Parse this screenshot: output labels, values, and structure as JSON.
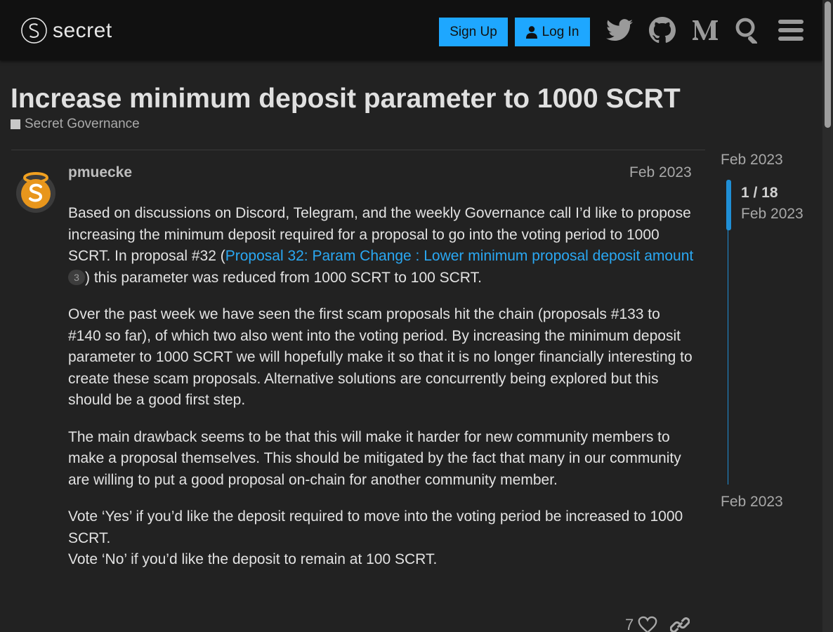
{
  "header": {
    "logo_text": "secret",
    "signup_label": "Sign Up",
    "login_label": "Log In",
    "icons": [
      "twitter-icon",
      "github-icon",
      "medium-icon",
      "search-icon",
      "hamburger-menu-icon"
    ],
    "accent_color": "#1ea7ff"
  },
  "topic": {
    "title": "Increase minimum deposit parameter to 1000 SCRT",
    "category": "Secret Governance"
  },
  "post": {
    "username": "pmuecke",
    "date": "Feb 2023",
    "p1_a": "Based on discussions on Discord, Telegram, and the weekly Governance call I’d like to propose increasing the minimum deposit required for a proposal to go into the voting period to 1000 SCRT. In proposal #32 (",
    "p1_link": "Proposal 32: Param Change : Lower minimum proposal deposit amount",
    "p1_link_clicks": "3",
    "p1_b": ") this parameter was reduced from 1000 SCRT to 100 SCRT.",
    "p2": "Over the past week we have seen the first scam proposals hit the chain (proposals #133 to #140 so far), of which two also went into the voting period. By increasing the minimum deposit parameter to 1000 SCRT we will hopefully make it so that it is no longer financially interesting to create these scam proposals. Alternative solutions are concurrently being explored but this should be a good first step.",
    "p3": "The main drawback seems to be that this will make it harder for new community members to make a proposal themselves. This should be mitigated by the fact that many in our community are willing to put a good proposal on-chain for another community member.",
    "p4_line1": "Vote ‘Yes’ if you’d like the deposit required to move into the voting period be increased to 1000 SCRT.",
    "p4_line2": "Vote ‘No’ if you’d like the deposit to remain at 100 SCRT.",
    "likes": "7"
  },
  "timeline": {
    "start_date": "Feb 2023",
    "position": "1 / 18",
    "position_date": "Feb 2023",
    "end_date": "Feb 2023"
  }
}
